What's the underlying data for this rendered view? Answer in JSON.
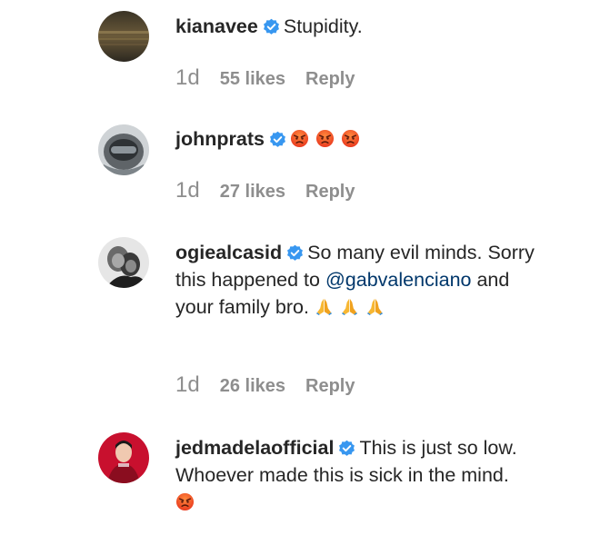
{
  "comments": [
    {
      "username": "kianavee",
      "text": "Stupidity.",
      "time": "1d",
      "likes": "55 likes",
      "reply": "Reply"
    },
    {
      "username": "johnprats",
      "text": "",
      "emojis": [
        "angry-face",
        "angry-face",
        "angry-face"
      ],
      "time": "1d",
      "likes": "27 likes",
      "reply": "Reply"
    },
    {
      "username": "ogiealcasid",
      "text": "So many evil minds. Sorry this happened to",
      "mention": "@gabvalenciano",
      "text_after": "and your family bro.",
      "emojis": [
        "folded-hands",
        "folded-hands",
        "folded-hands"
      ],
      "time": "1d",
      "likes": "26 likes",
      "reply": "Reply"
    },
    {
      "username": "jedmadelaofficial",
      "text": "This is just so low. Whoever made this is sick in the mind.",
      "emojis": [
        "angry-face"
      ],
      "time": "",
      "likes": "",
      "reply": ""
    }
  ],
  "colors": {
    "text": "#262626",
    "meta": "#8e8e8e",
    "mention": "#00376b",
    "verified": "#3897f0"
  }
}
